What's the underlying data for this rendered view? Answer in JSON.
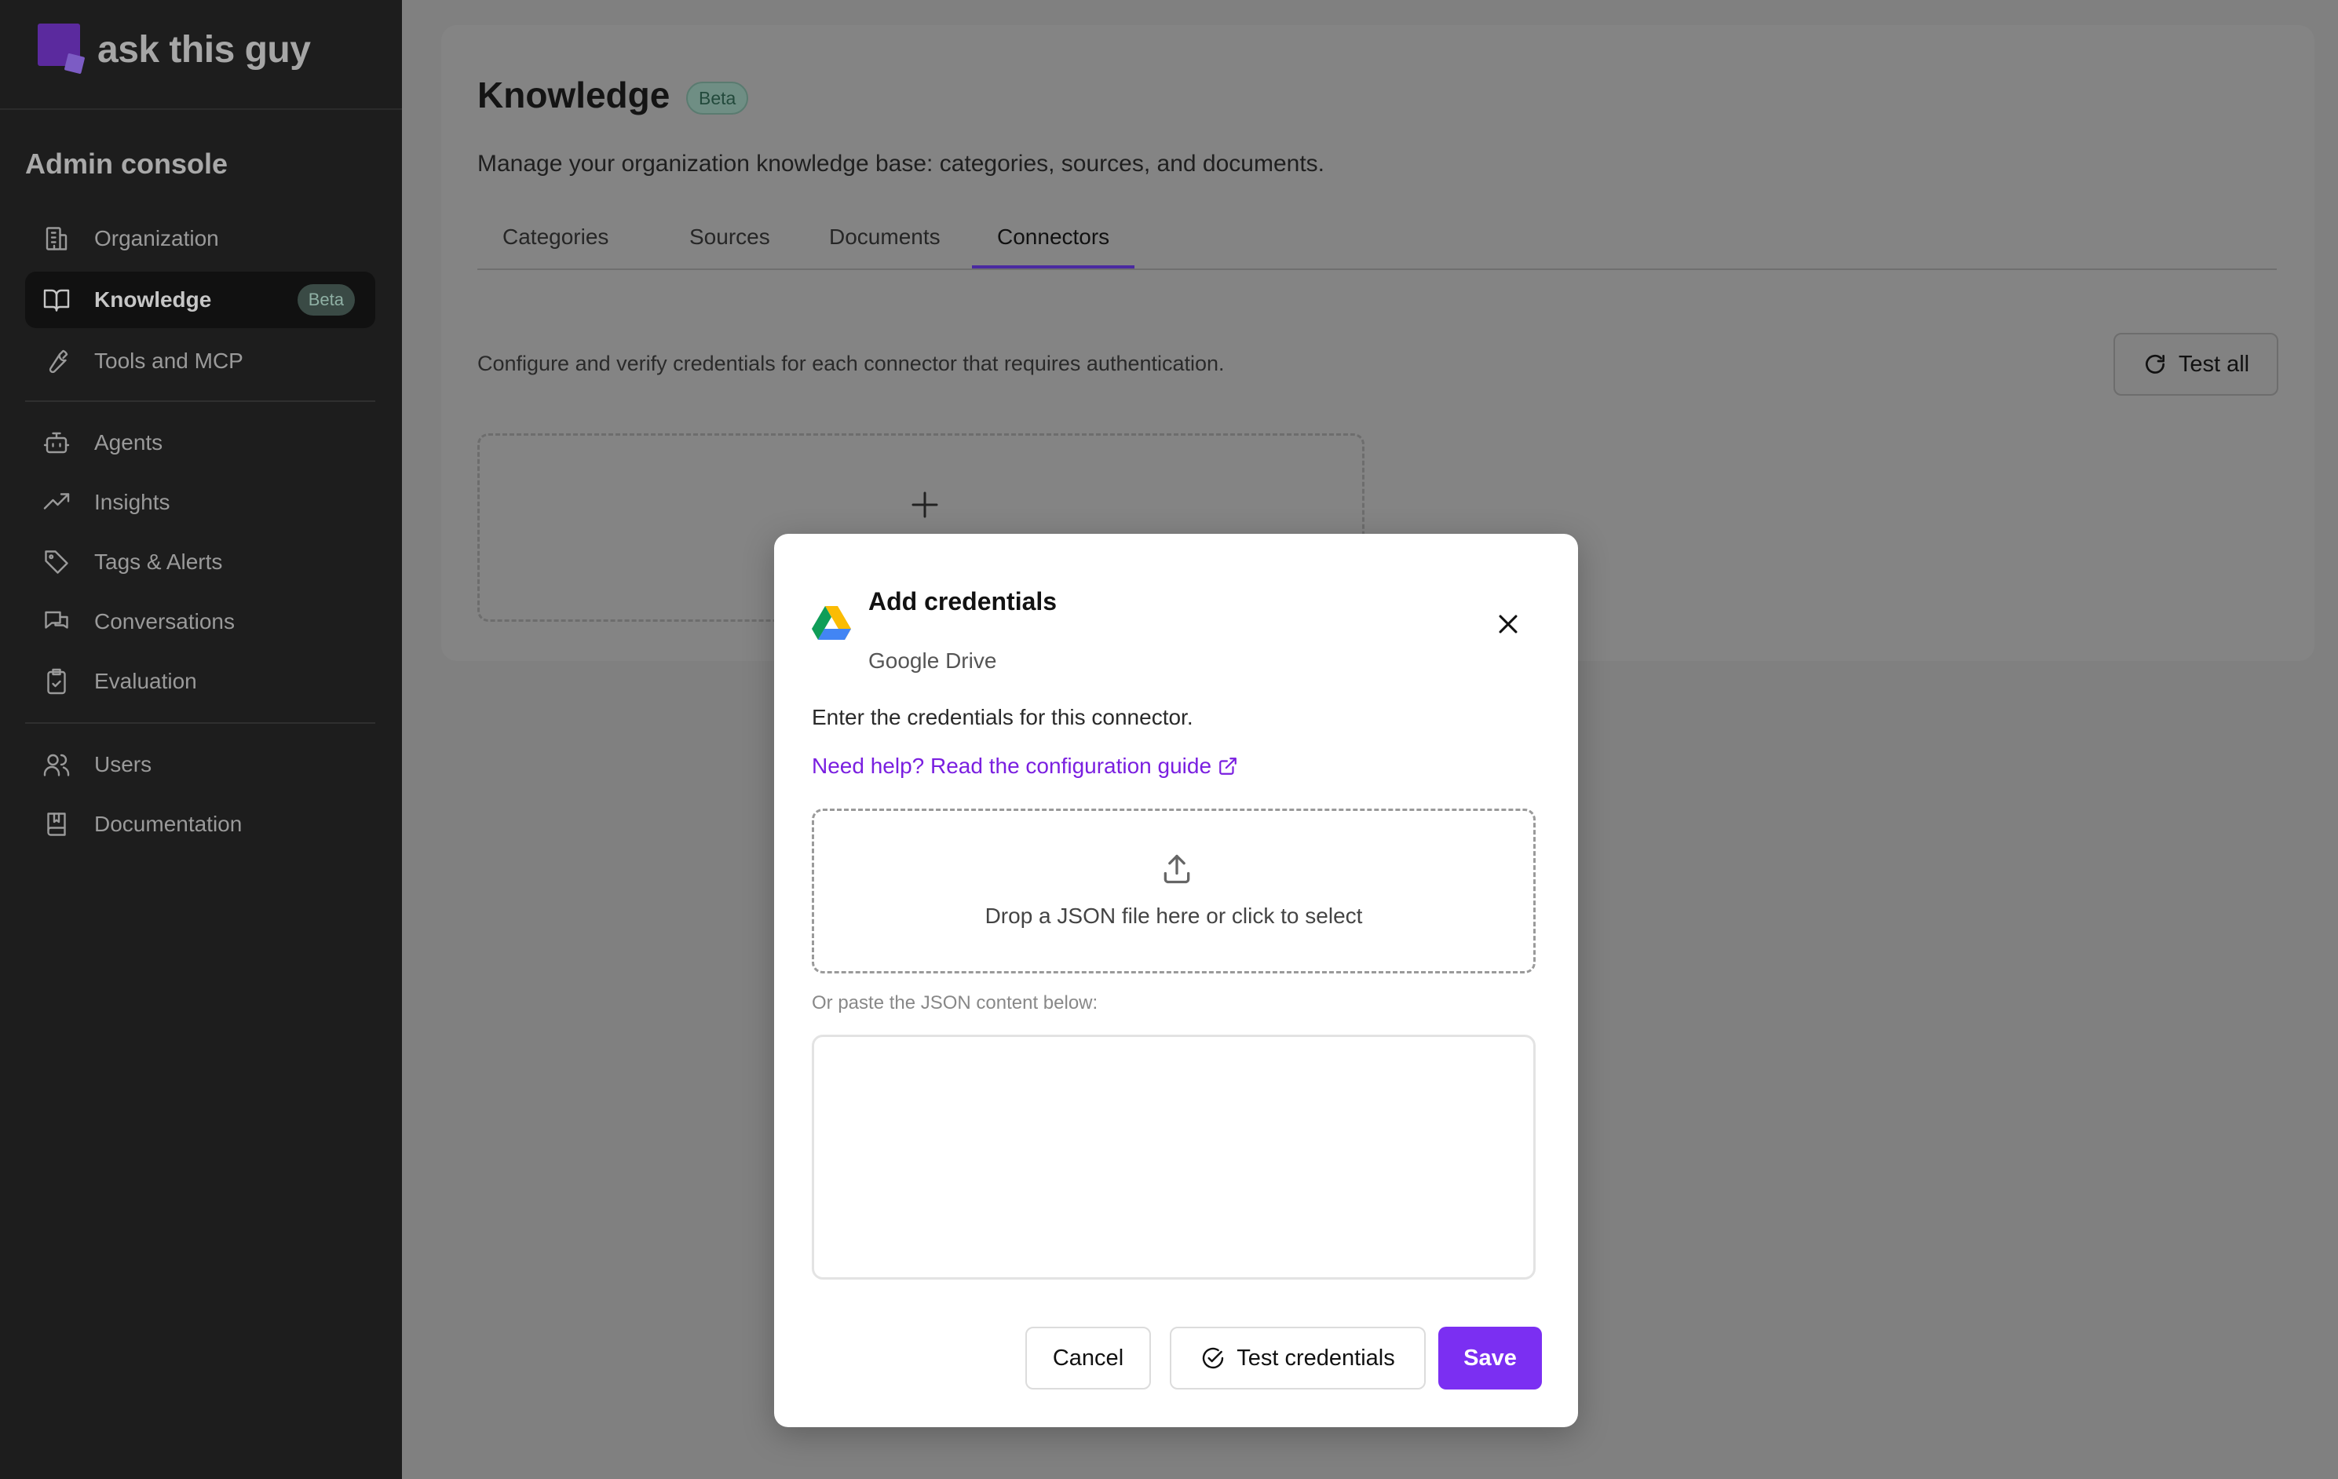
{
  "brand": {
    "name": "ask this guy"
  },
  "sidebar": {
    "title": "Admin console",
    "items": [
      {
        "label": "Organization",
        "icon": "building-icon"
      },
      {
        "label": "Knowledge",
        "icon": "book-open-icon",
        "badge": "Beta",
        "active": true
      },
      {
        "label": "Tools and MCP",
        "icon": "wrench-icon"
      },
      {
        "label": "Agents",
        "icon": "robot-icon"
      },
      {
        "label": "Insights",
        "icon": "trending-up-icon"
      },
      {
        "label": "Tags & Alerts",
        "icon": "tag-icon"
      },
      {
        "label": "Conversations",
        "icon": "chat-bubbles-icon"
      },
      {
        "label": "Evaluation",
        "icon": "clipboard-check-icon"
      },
      {
        "label": "Users",
        "icon": "users-icon"
      },
      {
        "label": "Documentation",
        "icon": "book-icon"
      }
    ]
  },
  "page": {
    "title": "Knowledge",
    "badge": "Beta",
    "description": "Manage your organization knowledge base: categories, sources, and documents.",
    "tabs": [
      {
        "label": "Categories"
      },
      {
        "label": "Sources"
      },
      {
        "label": "Documents"
      },
      {
        "label": "Connectors",
        "active": true
      }
    ],
    "connectors_description": "Configure and verify credentials for each connector that requires authentication.",
    "test_all_label": "Test all"
  },
  "modal": {
    "title": "Add credentials",
    "subtitle": "Google Drive",
    "intro": "Enter the credentials for this connector.",
    "help_link": "Need help? Read the configuration guide",
    "dropzone_text": "Drop a JSON file here or click to select",
    "paste_label": "Or paste the JSON content below:",
    "json_value": "",
    "cancel_label": "Cancel",
    "test_label": "Test credentials",
    "save_label": "Save"
  },
  "colors": {
    "accent": "#7b2ff2",
    "link": "#7a1fe0",
    "sidebar_bg": "#1d1d1d",
    "overlay": "#808080",
    "badge_green": "#2f6b57"
  }
}
